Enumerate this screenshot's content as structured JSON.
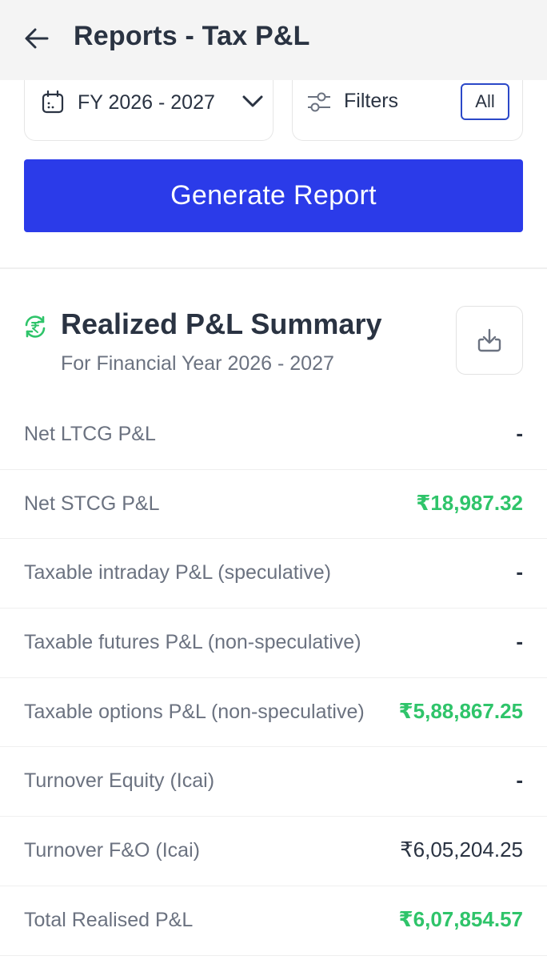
{
  "header": {
    "title": "Reports - Tax P&L"
  },
  "selectors": {
    "fy_label": "FY 2026 - 2027",
    "filters_label": "Filters",
    "filters_badge": "All"
  },
  "actions": {
    "generate_label": "Generate Report"
  },
  "summary": {
    "title": "Realized P&L Summary",
    "subtitle": "For Financial Year 2026 - 2027"
  },
  "colors": {
    "primary": "#2b3be9",
    "positive": "#2fc46a",
    "text": "#2a3342",
    "muted": "#6b7280"
  },
  "rows": [
    {
      "label": "Net LTCG P&L",
      "value": "-",
      "tone": "dash"
    },
    {
      "label": "Net STCG P&L",
      "value": "₹18,987.32",
      "tone": "green"
    },
    {
      "label": "Taxable intraday P&L (speculative)",
      "value": "-",
      "tone": "dash"
    },
    {
      "label": "Taxable futures P&L (non-speculative)",
      "value": "-",
      "tone": "dash"
    },
    {
      "label": "Taxable options P&L (non-speculative)",
      "value": "₹5,88,867.25",
      "tone": "green"
    },
    {
      "label": "Turnover Equity (Icai)",
      "value": "-",
      "tone": "dash"
    },
    {
      "label": "Turnover F&O (Icai)",
      "value": "₹6,05,204.25",
      "tone": "dark"
    },
    {
      "label": "Total Realised P&L",
      "value": "₹6,07,854.57",
      "tone": "green"
    }
  ]
}
